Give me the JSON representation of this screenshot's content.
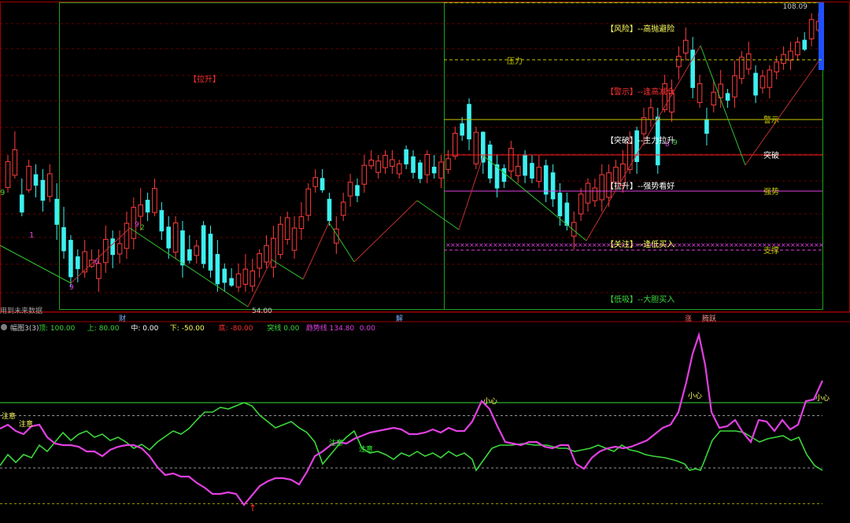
{
  "colors": {
    "background": "#000000",
    "up": "#ff3c3c",
    "down": "#3cf0f0",
    "grid": "#6a0000",
    "frame": "#a00000",
    "green_box": "#1fa01f",
    "yellow_box": "#c8c800",
    "magenta": "#e040e0",
    "green_line": "#3cd83c"
  },
  "top_panel": {
    "price_label_top": "108.09",
    "price_label_low": "54.00",
    "left_note": "用到未来数据",
    "label_lasheng_left": "【拉升】",
    "left_digit_9": "9",
    "left_digit_1": "1",
    "wave_digits": [
      "6",
      "9",
      "2",
      "8",
      "9",
      "9"
    ],
    "right_labels": [
      {
        "key": "risk",
        "text": "【风险】--高抛避险",
        "color": "#ffff60"
      },
      {
        "key": "warn",
        "text": "【警示】--逢高减仓",
        "color": "#ff3030"
      },
      {
        "key": "breakout",
        "text": "【突破】--主力拉升",
        "color": "#ffffff"
      },
      {
        "key": "lift",
        "text": "【拉升】--强势看好",
        "color": "#ffffff"
      },
      {
        "key": "attention",
        "text": "【关注】--逢低买入",
        "color": "#ffff60"
      },
      {
        "key": "lowabs",
        "text": "【低吸】--大胆买入",
        "color": "#3cd83c"
      }
    ],
    "level_labels": {
      "pressure": "压力",
      "warning": "警示",
      "breakout": "突破",
      "strong": "强势",
      "support": "支撑"
    },
    "bottom_tags": {
      "cai": "财",
      "jie": "解",
      "zhang": "涨",
      "tengyue": "腾跃"
    }
  },
  "indicator_header": {
    "name": "幅图3(3)",
    "items": [
      {
        "label": "顶:",
        "value": "100.00",
        "color": "#3cd83c"
      },
      {
        "label": "上:",
        "value": "80.00",
        "color": "#3cd83c"
      },
      {
        "label": "中:",
        "value": "0.00",
        "color": "#ffffff"
      },
      {
        "label": "下:",
        "value": "-50.00",
        "color": "#ffff60"
      },
      {
        "label": "底:",
        "value": "-80.00",
        "color": "#ff3030"
      },
      {
        "label": "突线",
        "value": "0.00",
        "color": "#3cd83c"
      },
      {
        "label": "趋势线",
        "value": "134.80",
        "color": "#e040e0"
      },
      {
        "label": "",
        "value": "0.00",
        "color": "#e040e0"
      }
    ]
  },
  "bottom_labels": {
    "attention": "注意",
    "attention2": "注意",
    "attention3": "注意",
    "attention4": "注意",
    "careful": "小心",
    "careful2": "小心",
    "careful3": "小心",
    "arrow": "↑"
  },
  "chart_data": {
    "type": "candlestick",
    "candles": [
      [
        1,
        78,
        70,
        71.1,
        76.6
      ],
      [
        1,
        83,
        73,
        73.7,
        79.1
      ],
      [
        0,
        73,
        65,
        65.8,
        69.6
      ],
      [
        1,
        77,
        70,
        70.6,
        75.6
      ],
      [
        0,
        76,
        69,
        71.5,
        73.9
      ],
      [
        0,
        75,
        66,
        68.3,
        72.7
      ],
      [
        1,
        76,
        68,
        69.2,
        74.0
      ],
      [
        0,
        72,
        60,
        63.2,
        68.7
      ],
      [
        0,
        67,
        56,
        57.6,
        62.7
      ],
      [
        0,
        61,
        50,
        52.1,
        60.0
      ],
      [
        0,
        58,
        51,
        53.8,
        56.5
      ],
      [
        1,
        60,
        52,
        53.2,
        57.5
      ],
      [
        1,
        58,
        54,
        54.4,
        55.7
      ],
      [
        1,
        58,
        49,
        51.8,
        55.0
      ],
      [
        1,
        63,
        53,
        55.2,
        60.1
      ],
      [
        0,
        62,
        54,
        56.8,
        60.3
      ],
      [
        1,
        62,
        55,
        57.0,
        59.2
      ],
      [
        1,
        66,
        56,
        58.2,
        63.5
      ],
      [
        1,
        69,
        58,
        60.3,
        66.9
      ],
      [
        1,
        71,
        62,
        65.0,
        67.4
      ],
      [
        0,
        70,
        64,
        65.8,
        68.5
      ],
      [
        1,
        73,
        65,
        65.8,
        70.9
      ],
      [
        0,
        68,
        60,
        61.8,
        66.3
      ],
      [
        0,
        65,
        56,
        58.2,
        62.8
      ],
      [
        1,
        65,
        56,
        57.4,
        63.6
      ],
      [
        0,
        64,
        52,
        54.6,
        62.0
      ],
      [
        0,
        61,
        55,
        55.6,
        58.0
      ],
      [
        1,
        60,
        55,
        56.7,
        58.7
      ],
      [
        0,
        64,
        54,
        54.9,
        63.1
      ],
      [
        0,
        63,
        52,
        53.5,
        61.3
      ],
      [
        0,
        60,
        49,
        50.6,
        57.0
      ],
      [
        0,
        55,
        49,
        50.9,
        53.9
      ],
      [
        0,
        54,
        50,
        50.3,
        51.9
      ],
      [
        1,
        55,
        49,
        50.0,
        52.8
      ],
      [
        1,
        57,
        49,
        50.6,
        53.8
      ],
      [
        1,
        56,
        49,
        50.2,
        53.4
      ],
      [
        1,
        58,
        52,
        54.0,
        57.1
      ],
      [
        1,
        61,
        54,
        55.3,
        58.8
      ],
      [
        1,
        63,
        52,
        54.2,
        60.3
      ],
      [
        1,
        65,
        56,
        56.9,
        63.3
      ],
      [
        1,
        66,
        59,
        60.1,
        64.7
      ],
      [
        1,
        65,
        56,
        57.8,
        62.5
      ],
      [
        1,
        68,
        60,
        62.4,
        64.9
      ],
      [
        1,
        72,
        64,
        65.2,
        70.8
      ],
      [
        1,
        75,
        70,
        71.3,
        73.2
      ],
      [
        0,
        75,
        70,
        70.5,
        73.1
      ],
      [
        0,
        70,
        63,
        64.0,
        68.7
      ],
      [
        1,
        65,
        57,
        59.3,
        62.3
      ],
      [
        1,
        70,
        64,
        65.2,
        68.0
      ],
      [
        1,
        74,
        67,
        69.3,
        72.2
      ],
      [
        0,
        73,
        68,
        69.3,
        71.6
      ],
      [
        1,
        78,
        70,
        71.8,
        75.8
      ],
      [
        1,
        79,
        75,
        75.7,
        76.9
      ],
      [
        1,
        78,
        73,
        74.3,
        76.7
      ],
      [
        1,
        79,
        74,
        75.3,
        77.9
      ],
      [
        1,
        79,
        74,
        75.6,
        77.0
      ],
      [
        1,
        77,
        73,
        74.0,
        76.1
      ],
      [
        0,
        80,
        75,
        76.0,
        79.2
      ],
      [
        0,
        79,
        73,
        74.2,
        77.7
      ],
      [
        0,
        77,
        72,
        72.9,
        76.4
      ],
      [
        1,
        79,
        72,
        73.8,
        78.1
      ],
      [
        0,
        78,
        73,
        74.1,
        75.5
      ],
      [
        1,
        78,
        71,
        73.1,
        76.5
      ],
      [
        1,
        79,
        74,
        74.9,
        77.2
      ],
      [
        1,
        84,
        77,
        77.7,
        82.6
      ],
      [
        0,
        86,
        81,
        82.1,
        84.7
      ],
      [
        0,
        90,
        79,
        81.3,
        88.8
      ],
      [
        1,
        84,
        75,
        76.1,
        82.8
      ],
      [
        0,
        83,
        74,
        76.4,
        82.9
      ],
      [
        0,
        81,
        72,
        73.0,
        80.2
      ],
      [
        0,
        78,
        69,
        70.9,
        76.0
      ],
      [
        0,
        76,
        71,
        72.3,
        75.2
      ],
      [
        1,
        81,
        73,
        74.6,
        79.4
      ],
      [
        1,
        78,
        72,
        73.6,
        75.6
      ],
      [
        0,
        79,
        72,
        73.6,
        78.1
      ],
      [
        0,
        78,
        72,
        73.0,
        76.3
      ],
      [
        1,
        78,
        71,
        72.4,
        75.4
      ],
      [
        0,
        77,
        68,
        69.6,
        75.8
      ],
      [
        0,
        76,
        67,
        68.6,
        74.3
      ],
      [
        0,
        72,
        63,
        65.0,
        70.0
      ],
      [
        0,
        70,
        62,
        63.0,
        67.9
      ],
      [
        1,
        66,
        58,
        60.8,
        63.7
      ],
      [
        1,
        71,
        64,
        65.5,
        69.7
      ],
      [
        1,
        73,
        66,
        67.8,
        72.0
      ],
      [
        1,
        73,
        67,
        68.3,
        71.0
      ],
      [
        1,
        76,
        66,
        68.5,
        73.8
      ],
      [
        1,
        76,
        67,
        69.0,
        74.2
      ],
      [
        1,
        77,
        71,
        72.2,
        75.4
      ],
      [
        1,
        79,
        70,
        71.6,
        76.1
      ],
      [
        1,
        83,
        74,
        74.9,
        80.5
      ],
      [
        0,
        84,
        74,
        76.5,
        83.2
      ],
      [
        1,
        88,
        80,
        82.5,
        85.9
      ],
      [
        1,
        90,
        84,
        85.5,
        88.0
      ],
      [
        0,
        88,
        74,
        75.8,
        86.1
      ],
      [
        1,
        95,
        87,
        87.6,
        93.1
      ],
      [
        1,
        94,
        85,
        87.1,
        91.1
      ],
      [
        1,
        101,
        94,
        96.7,
        98.9
      ],
      [
        1,
        105,
        98,
        99.6,
        102.3
      ],
      [
        0,
        103,
        90,
        92.2,
        100.3
      ],
      [
        1,
        95,
        88,
        89.1,
        93.1
      ],
      [
        0,
        88,
        80,
        82.5,
        85.6
      ],
      [
        1,
        94,
        87,
        88.6,
        91.3
      ],
      [
        1,
        96,
        88,
        90.1,
        93.0
      ],
      [
        0,
        92,
        88,
        89.5,
        91.1
      ],
      [
        1,
        98,
        88,
        90.3,
        94.8
      ],
      [
        1,
        100,
        93,
        94.2,
        98.7
      ],
      [
        1,
        102,
        95,
        96.2,
        99.4
      ],
      [
        0,
        97,
        89,
        90.6,
        95.4
      ],
      [
        1,
        96,
        91,
        92.2,
        94.7
      ],
      [
        1,
        97,
        90,
        92.3,
        96.0
      ],
      [
        1,
        99,
        94,
        95.6,
        97.7
      ],
      [
        1,
        101,
        96,
        97.4,
        99.3
      ],
      [
        1,
        102,
        96,
        98.1,
        100.0
      ],
      [
        1,
        103,
        98,
        99.2,
        101.9
      ],
      [
        0,
        104,
        100,
        100.3,
        102.4
      ],
      [
        1,
        108,
        101,
        102.6,
        106.7
      ],
      [
        1,
        108.09,
        104,
        104.5,
        106.3
      ]
    ]
  }
}
